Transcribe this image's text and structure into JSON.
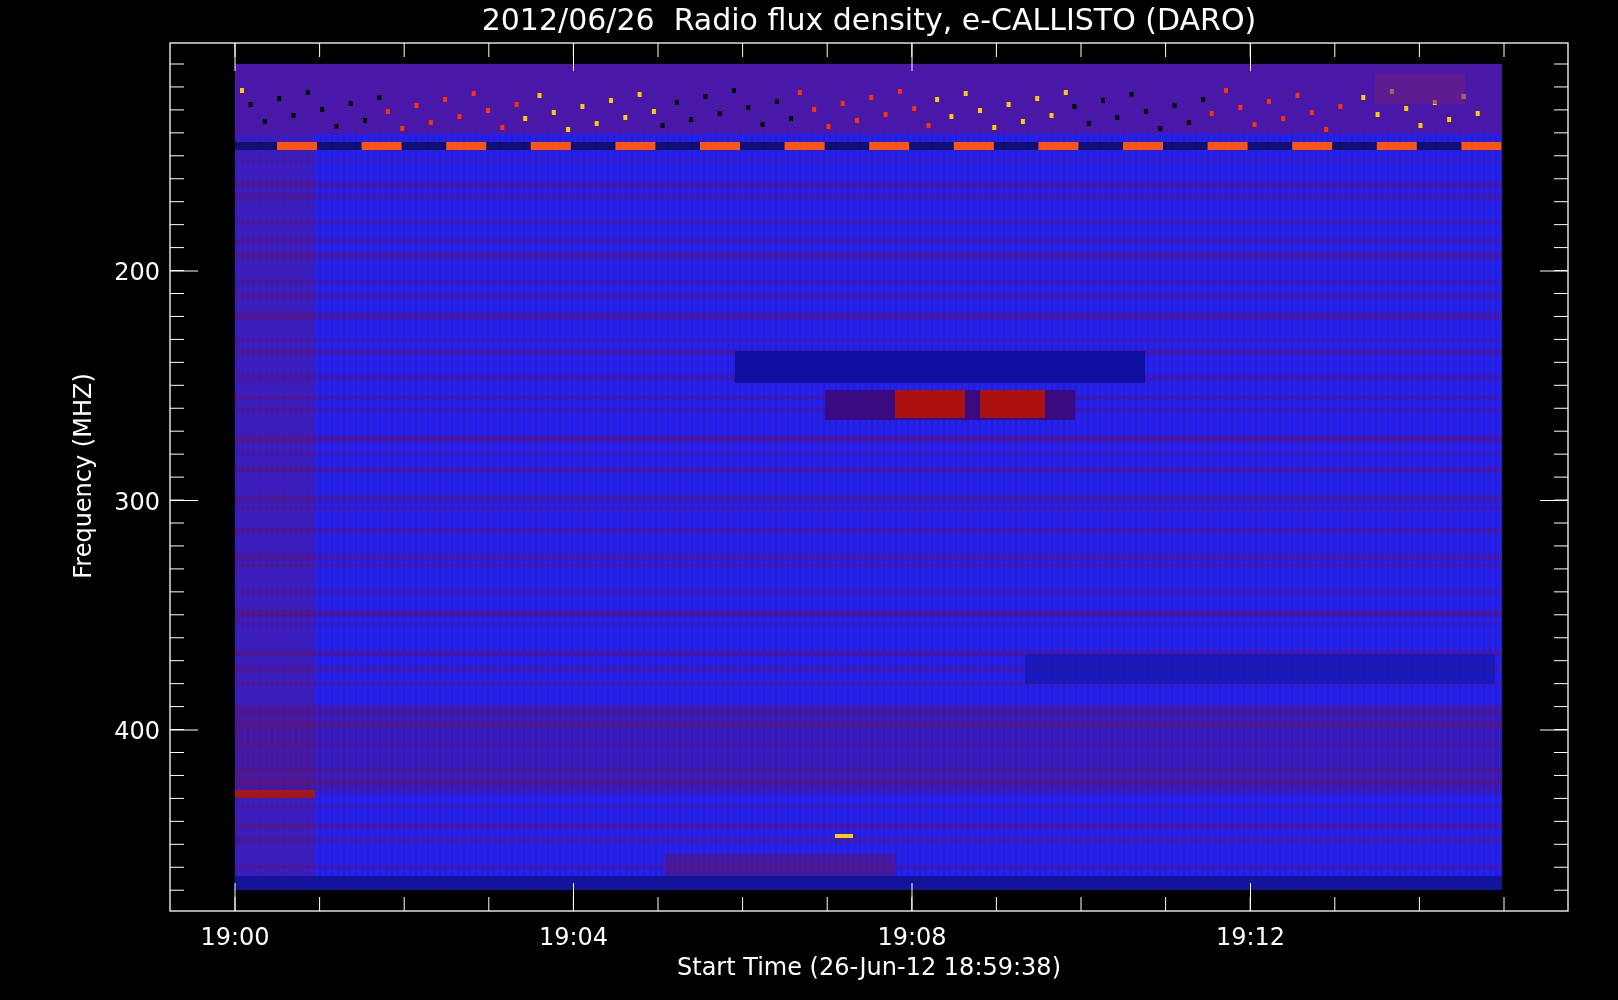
{
  "title": "2012/06/26  Radio flux density, e-CALLISTO (DARO)",
  "y_axis": {
    "label": "Frequency (MHZ)",
    "ticks": [
      "200",
      "300",
      "400"
    ]
  },
  "x_axis": {
    "label": "Start Time (26-Jun-12 18:59:38)",
    "ticks": [
      "19:00",
      "19:04",
      "19:08",
      "19:12"
    ]
  }
}
